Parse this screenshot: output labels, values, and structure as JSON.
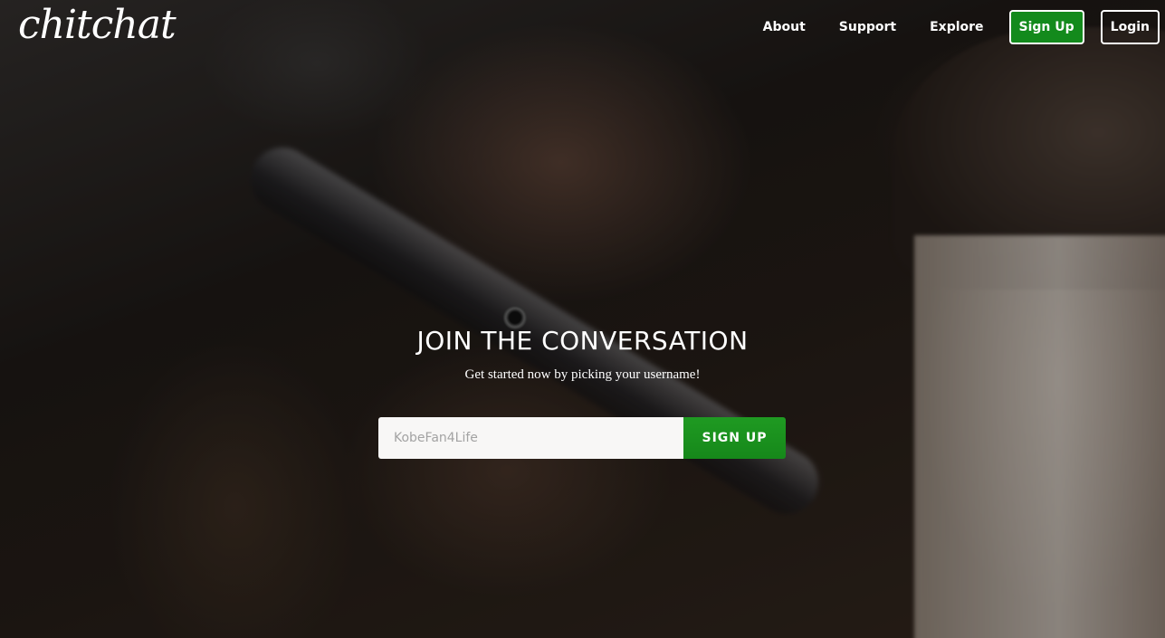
{
  "brand": {
    "logo_text": "chitchat"
  },
  "nav": {
    "links": [
      {
        "label": "About"
      },
      {
        "label": "Support"
      },
      {
        "label": "Explore"
      }
    ],
    "signup_label": "Sign Up",
    "login_label": "Login"
  },
  "hero": {
    "headline": "JOIN THE CONVERSATION",
    "subheadline": "Get started now by picking your username!",
    "input_placeholder": "KobeFan4Life",
    "input_value": "",
    "cta_label": "SIGN UP"
  },
  "colors": {
    "accent_green": "#1a921d",
    "text": "#ffffff",
    "input_bg": "#f8f7f6"
  }
}
